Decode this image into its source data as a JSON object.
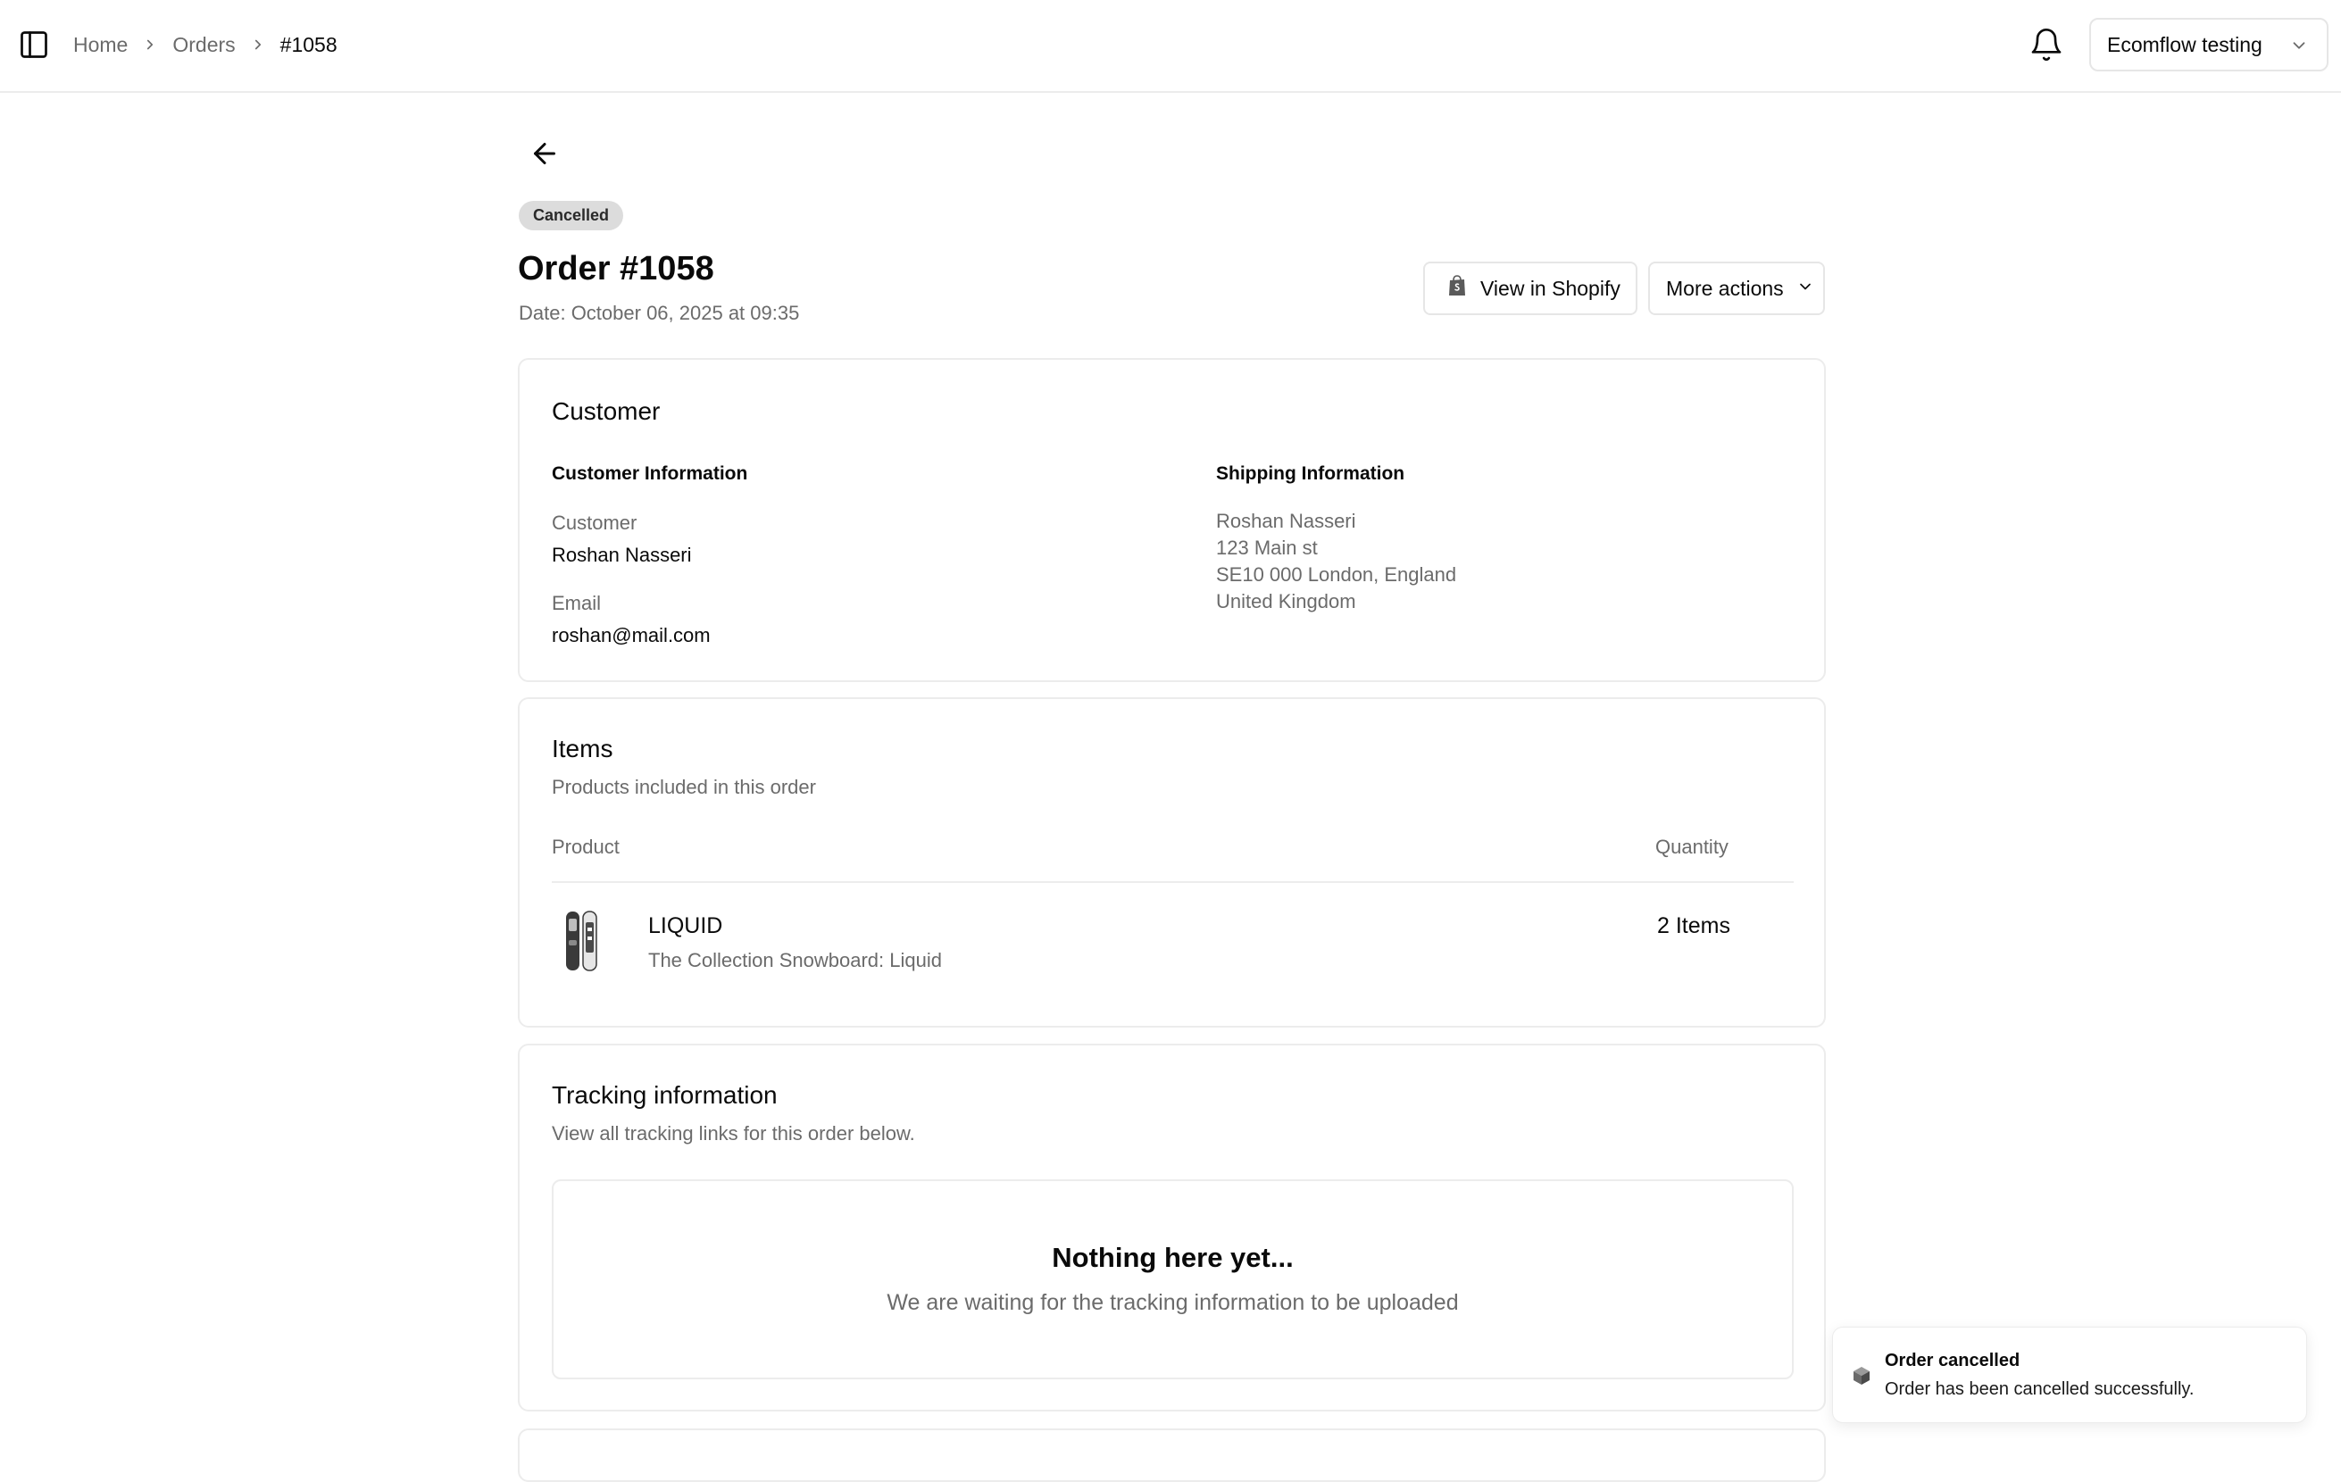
{
  "breadcrumb": {
    "items": [
      "Home",
      "Orders"
    ],
    "current": "#1058"
  },
  "header": {
    "store_name": "Ecomflow testing"
  },
  "order": {
    "status": "Cancelled",
    "title": "Order #1058",
    "date": "Date: October 06, 2025 at 09:35",
    "status_color": "#dcdcdc"
  },
  "actions": {
    "view_in_shopify": "View in Shopify",
    "more_actions": "More actions"
  },
  "customer_card": {
    "title": "Customer",
    "customer_info": {
      "heading": "Customer Information",
      "customer_label": "Customer",
      "customer_value": "Roshan Nasseri",
      "email_label": "Email",
      "email_value": "roshan@mail.com"
    },
    "shipping_info": {
      "heading": "Shipping Information",
      "lines": [
        "Roshan Nasseri",
        "123 Main st",
        "SE10 000 London, England",
        "United Kingdom"
      ]
    }
  },
  "items_card": {
    "title": "Items",
    "subtitle": "Products included in this order",
    "columns": {
      "product": "Product",
      "quantity": "Quantity"
    },
    "rows": [
      {
        "name": "LIQUID",
        "description": "The Collection Snowboard: Liquid",
        "quantity": "2 Items",
        "thumbnail_icon": "snowboard-thumbnail"
      }
    ]
  },
  "tracking_card": {
    "title": "Tracking information",
    "subtitle": "View all tracking links for this order below.",
    "empty_title": "Nothing here yet...",
    "empty_message": "We are waiting for the tracking information to be uploaded"
  },
  "toast": {
    "title": "Order cancelled",
    "message": "Order has been cancelled successfully.",
    "icon": "package-icon"
  },
  "icons": {
    "sidebar_toggle": "sidebar-toggle-icon",
    "chevron_right": "chevron-right-icon",
    "bell": "bell-icon",
    "chevron_down": "chevron-down-icon",
    "back": "arrow-left-icon",
    "shopify": "shopify-bag-icon"
  }
}
